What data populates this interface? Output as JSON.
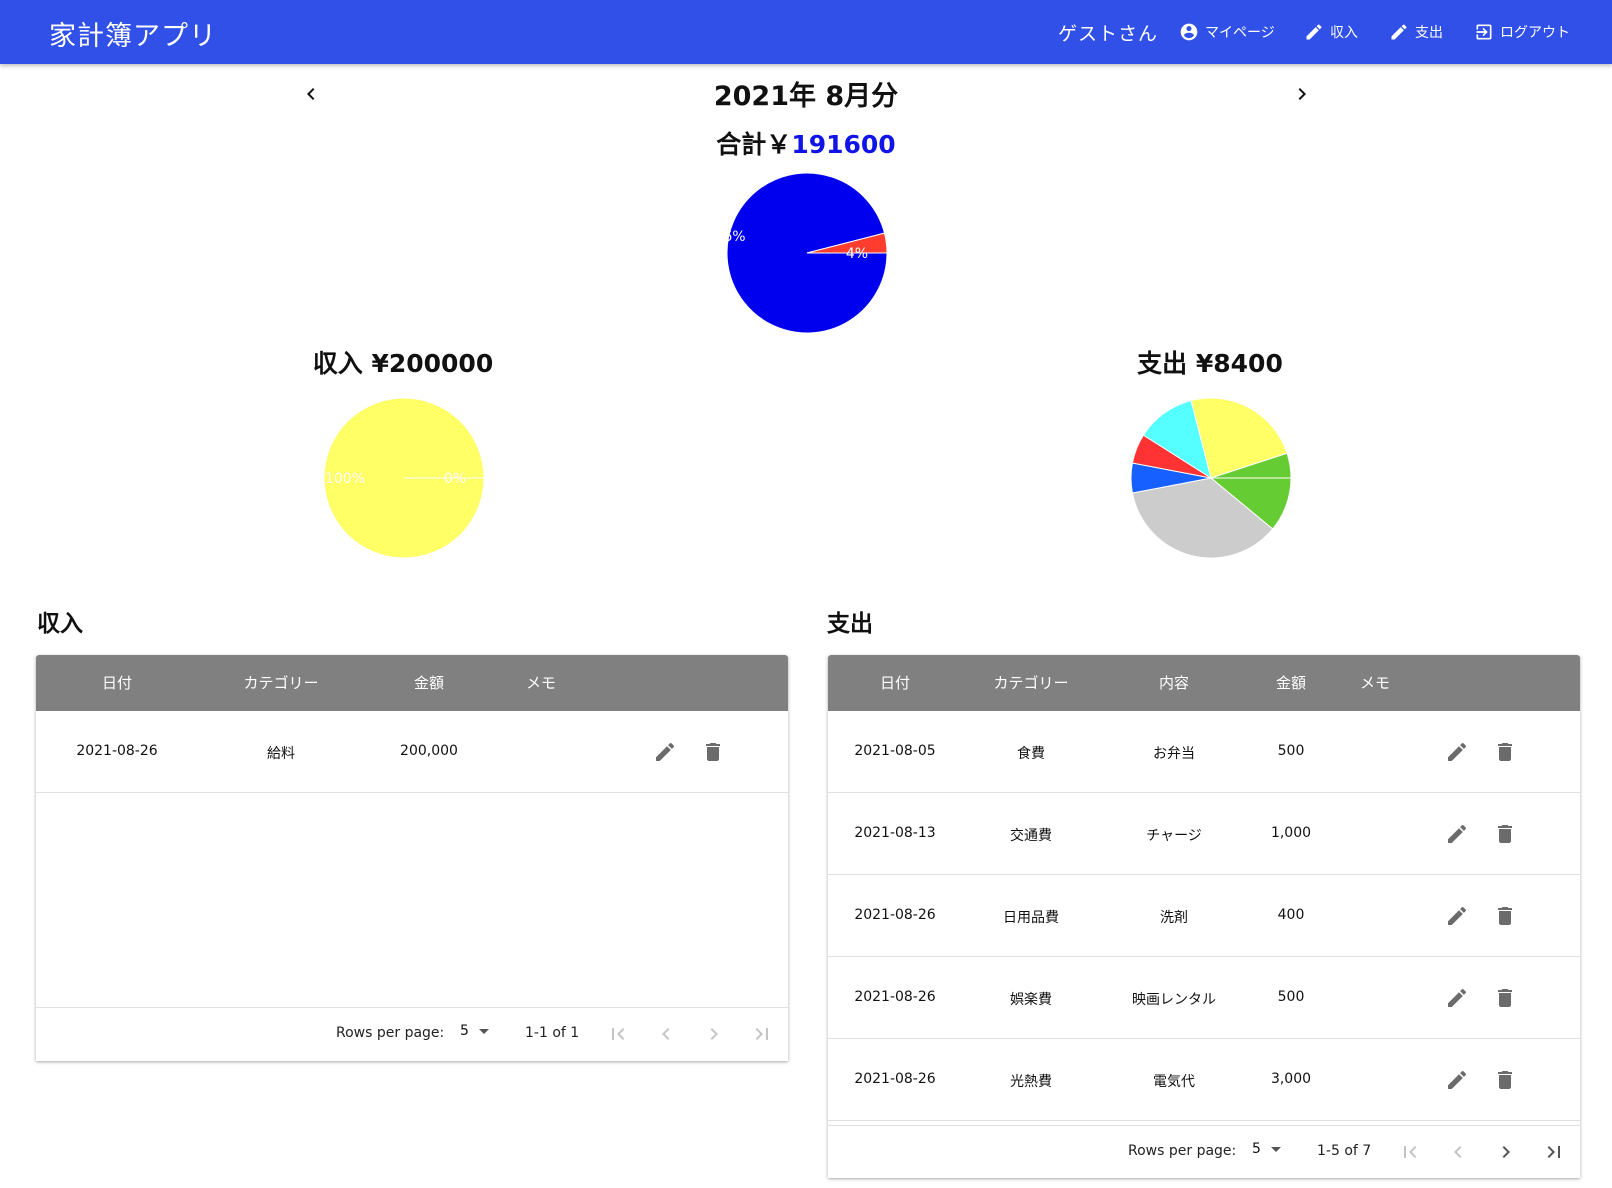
{
  "app": {
    "title": "家計簿アプリ",
    "user": "ゲストさん",
    "nav": [
      {
        "label": "マイページ",
        "icon": "account-circle-icon"
      },
      {
        "label": "収入",
        "icon": "pencil-icon"
      },
      {
        "label": "支出",
        "icon": "pencil-icon"
      },
      {
        "label": "ログアウト",
        "icon": "logout-icon"
      }
    ]
  },
  "month": {
    "title": "2021年 8月分"
  },
  "total": {
    "label": "合計￥",
    "amount": "191600"
  },
  "income_summary": {
    "title": "収入 ¥200000"
  },
  "expense_summary": {
    "title": "支出 ¥8400"
  },
  "colors": {
    "appbar": "#3050e8",
    "income_blue": "#0000ee",
    "expense_red": "#ff3d2e",
    "income_yellow": "#ffff66"
  },
  "chart_data": [
    {
      "type": "pie",
      "title": "合計￥191600",
      "slices": [
        {
          "label": "96%",
          "value": 96,
          "color": "#0000ee"
        },
        {
          "label": "4%",
          "value": 4,
          "color": "#ff3d2e"
        }
      ]
    },
    {
      "type": "pie",
      "title": "収入 ¥200000",
      "slices": [
        {
          "label": "100%",
          "value": 100,
          "color": "#ffff66"
        },
        {
          "label": "0%",
          "value": 0,
          "color": "#ffff66"
        }
      ]
    },
    {
      "type": "pie",
      "title": "支出 ¥8400",
      "slices": [
        {
          "label": "",
          "value": 11,
          "color": "#66cc33"
        },
        {
          "label": "",
          "value": 36,
          "color": "#cccccc"
        },
        {
          "label": "",
          "value": 6,
          "color": "#1560ff"
        },
        {
          "label": "",
          "value": 6,
          "color": "#ff3333"
        },
        {
          "label": "",
          "value": 12,
          "color": "#55ffff"
        },
        {
          "label": "",
          "value": 24,
          "color": "#ffff66"
        },
        {
          "label": "",
          "value": 5,
          "color": "#66cc33"
        }
      ]
    }
  ],
  "income": {
    "section_title": "収入",
    "headers": [
      "日付",
      "カテゴリー",
      "金額",
      "メモ"
    ],
    "rows": [
      {
        "date": "2021-08-26",
        "category": "給料",
        "amount": "200,000",
        "memo": ""
      }
    ],
    "footer": {
      "rows_per_page_label": "Rows per page:",
      "rows_per_page": "5",
      "range": "1-1 of 1"
    }
  },
  "expense": {
    "section_title": "支出",
    "headers": [
      "日付",
      "カテゴリー",
      "内容",
      "金額",
      "メモ"
    ],
    "rows": [
      {
        "date": "2021-08-05",
        "category": "食費",
        "content": "お弁当",
        "amount": "500",
        "memo": ""
      },
      {
        "date": "2021-08-13",
        "category": "交通費",
        "content": "チャージ",
        "amount": "1,000",
        "memo": ""
      },
      {
        "date": "2021-08-26",
        "category": "日用品費",
        "content": "洗剤",
        "amount": "400",
        "memo": ""
      },
      {
        "date": "2021-08-26",
        "category": "娯楽費",
        "content": "映画レンタル",
        "amount": "500",
        "memo": ""
      },
      {
        "date": "2021-08-26",
        "category": "光熱費",
        "content": "電気代",
        "amount": "3,000",
        "memo": ""
      }
    ],
    "footer": {
      "rows_per_page_label": "Rows per page:",
      "rows_per_page": "5",
      "range": "1-5 of 7"
    }
  }
}
